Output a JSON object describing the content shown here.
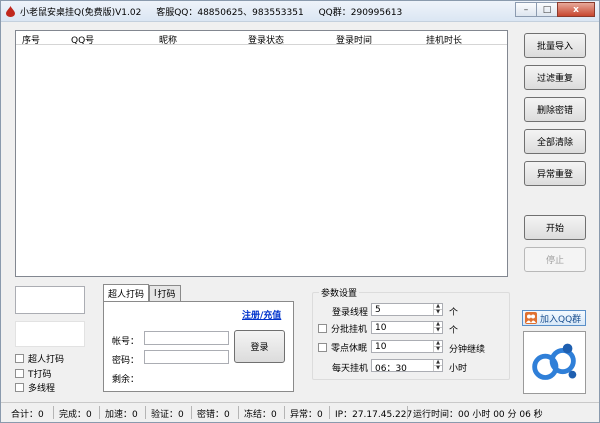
{
  "window": {
    "title_parts": [
      "小老鼠安桌挂Q(免费版)V1.02",
      "客服QQ：48850625、983553351",
      "QQ群：290995613"
    ],
    "controls": {
      "minimize": "–",
      "maximize": "□",
      "close": "x"
    }
  },
  "list": {
    "columns": [
      "序号",
      "QQ号",
      "昵称",
      "登录状态",
      "登录时间",
      "挂机时长"
    ],
    "rows": []
  },
  "side_buttons": [
    "批量导入",
    "过滤重复",
    "删除密错",
    "全部清除",
    "异常重登"
  ],
  "start_button": "开始",
  "stop_button": "停止",
  "captcha_options": [
    "超人打码",
    "T打码",
    "多线程"
  ],
  "tabs": [
    "超人打码",
    "打码"
  ],
  "login_panel": {
    "register_link": "注册/充值",
    "account_label": "帐号：",
    "password_label": "密码：",
    "remaining_label": "剩余：",
    "login_button": "登录"
  },
  "params": {
    "title": "参数设置",
    "login_threads": {
      "label": "登录线程",
      "value": "5",
      "unit": "个"
    },
    "batch_hang": {
      "label": "分批挂机",
      "value": "10",
      "unit": "个"
    },
    "zero_sleep": {
      "label": "零点休眠",
      "value": "10",
      "unit": "分钟继续"
    },
    "daily_hang": {
      "label": "每天挂机",
      "value": "06：30",
      "unit": "小时"
    }
  },
  "qq_group_button": "加入QQ群",
  "status": {
    "total_label": "合计：",
    "total": "0",
    "done_label": "完成：",
    "done": "0",
    "speed_label": "加速：",
    "speed": "0",
    "verify_label": "验证：",
    "verify": "0",
    "pwd_err_label": "密错：",
    "pwd_err": "0",
    "frozen_label": "冻结：",
    "frozen": "0",
    "abnormal_label": "异常：",
    "abnormal": "0",
    "ip_label": "IP：",
    "ip": "27.17.45.227",
    "runtime_label": "运行时间：",
    "runtime": "00 小时 00 分 06 秒"
  },
  "colors": {
    "link": "#0033cc",
    "close": "#c7462f",
    "logo_blue": "#2f7fd8"
  }
}
